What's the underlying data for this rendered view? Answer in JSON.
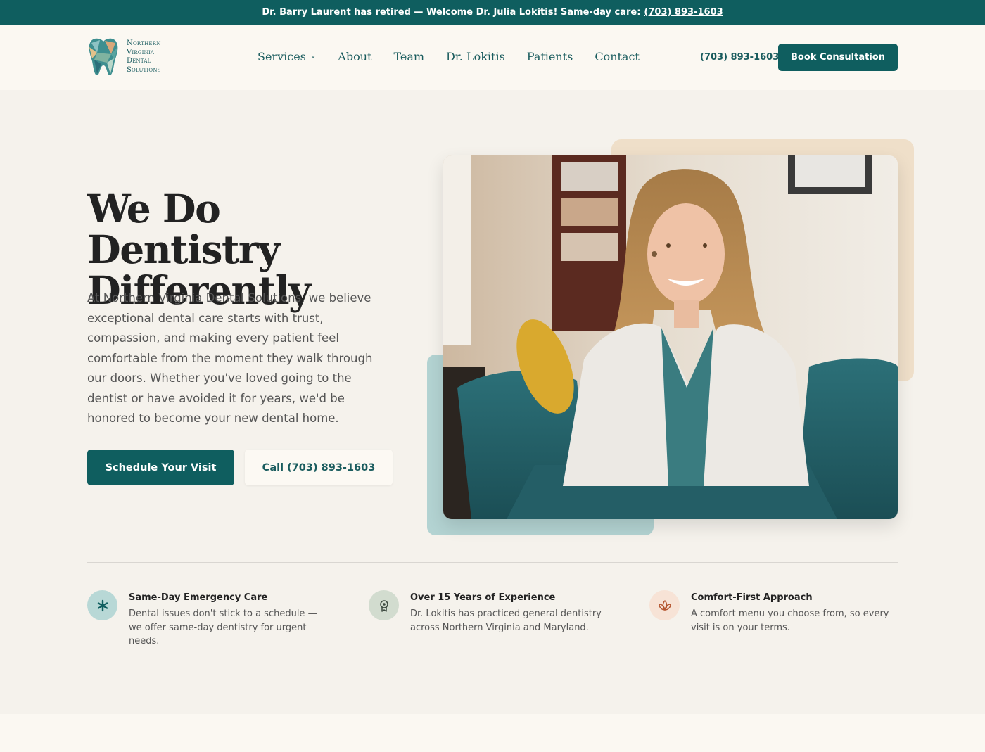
{
  "announcement": {
    "text": "Dr. Barry Laurent has retired — Welcome Dr. Julia Lokitis! Same-day care:",
    "phone": "(703) 893-1603"
  },
  "logo": {
    "line1": "Northern",
    "line2": "Virginia",
    "line3": "Dental",
    "line4": "Solutions"
  },
  "nav": {
    "items": [
      {
        "label": "Services",
        "has_dropdown": true
      },
      {
        "label": "About"
      },
      {
        "label": "Team"
      },
      {
        "label": "Dr. Lokitis"
      },
      {
        "label": "Patients"
      },
      {
        "label": "Contact"
      }
    ]
  },
  "header": {
    "phone": "(703) 893-1603",
    "cta": "Book Consultation"
  },
  "hero": {
    "title_line1": "We Do Dentistry",
    "title_line2": "Differently",
    "description": "At Northern Virginia Dental Solutions, we believe exceptional dental care starts with trust, compassion, and making every patient feel comfortable from the moment they walk through our doors. Whether you've loved going to the dentist or have avoided it for years, we'd be honored to become your new dental home.",
    "primary_button": "Schedule Your Visit",
    "secondary_button": "Call (703) 893-1603"
  },
  "features": [
    {
      "icon": "asterisk-icon",
      "title": "Same-Day Emergency Care",
      "description": "Dental issues don't stick to a schedule — we offer same-day dentistry for urgent needs."
    },
    {
      "icon": "award-icon",
      "title": "Over 15 Years of Experience",
      "description": "Dr. Lokitis has practiced general dentistry across Northern Virginia and Maryland."
    },
    {
      "icon": "lotus-icon",
      "title": "Comfort-First Approach",
      "description": "A comfort menu you choose from, so every visit is on your terms."
    }
  ],
  "colors": {
    "brand_teal": "#0f5e5f",
    "background": "#f5f2ec",
    "peach_accent": "#efdfc9",
    "light_teal_accent": "#b3d3d2"
  }
}
